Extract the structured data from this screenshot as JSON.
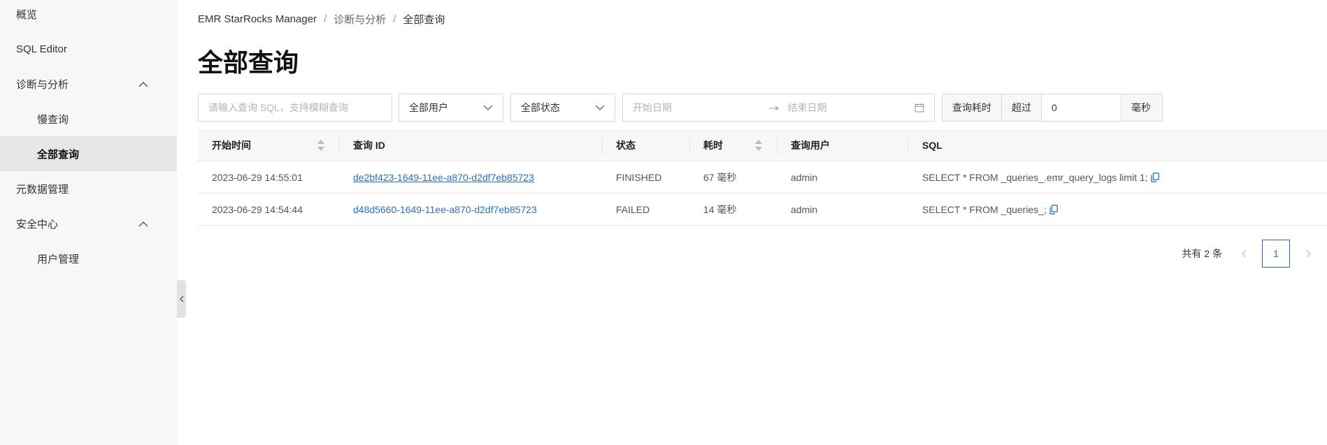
{
  "sidebar": {
    "items": [
      {
        "label": "概览"
      },
      {
        "label": "SQL Editor"
      },
      {
        "label": "诊断与分析"
      },
      {
        "label": "慢查询"
      },
      {
        "label": "全部查询"
      },
      {
        "label": "元数据管理"
      },
      {
        "label": "安全中心"
      },
      {
        "label": "用户管理"
      }
    ]
  },
  "breadcrumb": [
    "EMR StarRocks Manager",
    "诊断与分析",
    "全部查询"
  ],
  "page_title": "全部查询",
  "filters": {
    "search_placeholder": "请输入查询 SQL，支持模糊查询",
    "user_select": "全部用户",
    "status_select": "全部状态",
    "start_date_placeholder": "开始日期",
    "end_date_placeholder": "结束日期",
    "cost_label": "查询耗时",
    "cost_op": "超过",
    "cost_value": "0",
    "cost_unit": "毫秒"
  },
  "table": {
    "columns": [
      "开始时间",
      "查询 ID",
      "状态",
      "耗时",
      "查询用户",
      "SQL"
    ],
    "rows": [
      {
        "start": "2023-06-29 14:55:01",
        "id": "de2bf423-1649-11ee-a870-d2df7eb85723",
        "status": "FINISHED",
        "cost": "67 毫秒",
        "user": "admin",
        "sql": "SELECT * FROM _queries_.emr_query_logs limit 1;"
      },
      {
        "start": "2023-06-29 14:54:44",
        "id": "d48d5660-1649-11ee-a870-d2df7eb85723",
        "status": "FAILED",
        "cost": "14 毫秒",
        "user": "admin",
        "sql": "SELECT * FROM _queries_;"
      }
    ]
  },
  "pagination": {
    "total": "共有 2 条",
    "current": "1"
  },
  "colors": {
    "accent": "#2b6fc4",
    "sidebar_bg": "#f7f7f7",
    "active_bg": "#e6e6e6"
  }
}
